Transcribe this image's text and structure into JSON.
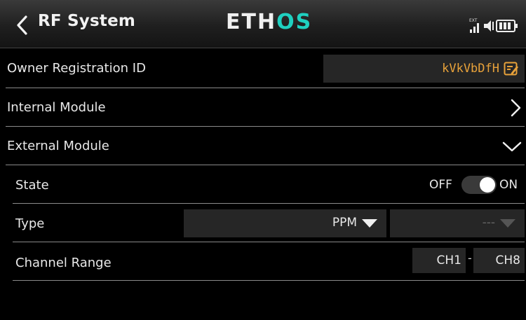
{
  "header": {
    "title": "RF System",
    "logo_main": "ETH",
    "logo_accent": "OS",
    "ext_indicator": "EXT"
  },
  "rows": {
    "owner": {
      "label": "Owner Registration ID",
      "value": "kVkVbDfH"
    },
    "internal": {
      "label": "Internal Module"
    },
    "external": {
      "label": "External Module"
    },
    "state": {
      "label": "State",
      "off": "OFF",
      "on": "ON",
      "enabled": true
    },
    "type": {
      "label": "Type",
      "value": "PPM",
      "sub_value": "---"
    },
    "channel_range": {
      "label": "Channel Range",
      "start": "CH1",
      "separator": "-",
      "end": "CH8"
    }
  },
  "colors": {
    "accent": "#e8a23a",
    "logo_accent": "#1fd0c0",
    "background": "#000000",
    "field": "#262626"
  }
}
